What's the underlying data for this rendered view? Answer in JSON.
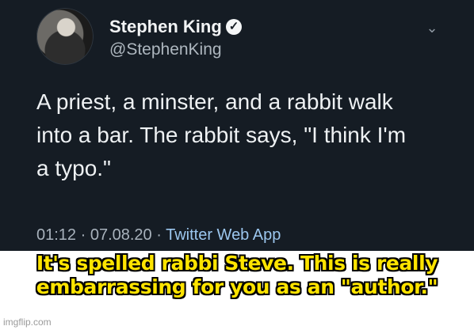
{
  "tweet": {
    "display_name": "Stephen King",
    "handle": "@StephenKing",
    "text": "A priest, a minster, and a rabbit walk into a bar. The rabbit says, \"I think I'm a typo.\"",
    "text_lines": [
      "A priest, a minster, and a rabbit walk",
      "into a bar. The rabbit says, \"I think I'm",
      "a typo.\""
    ],
    "timestamp": "01:12 · 07.08.20 · ",
    "source": "Twitter Web App",
    "icons": {
      "verified": "verified-badge-icon",
      "menu": "chevron-down-icon"
    }
  },
  "caption": {
    "line1": "It's spelled rabbi Steve. This is really",
    "line2": "embarrassing for you as an \"author.\""
  },
  "watermark": "imgflip.com",
  "colors": {
    "tweet_background": "#151c24",
    "caption_text": "#ffe400",
    "caption_outline": "#000000",
    "link_text": "#9cc7ef"
  }
}
